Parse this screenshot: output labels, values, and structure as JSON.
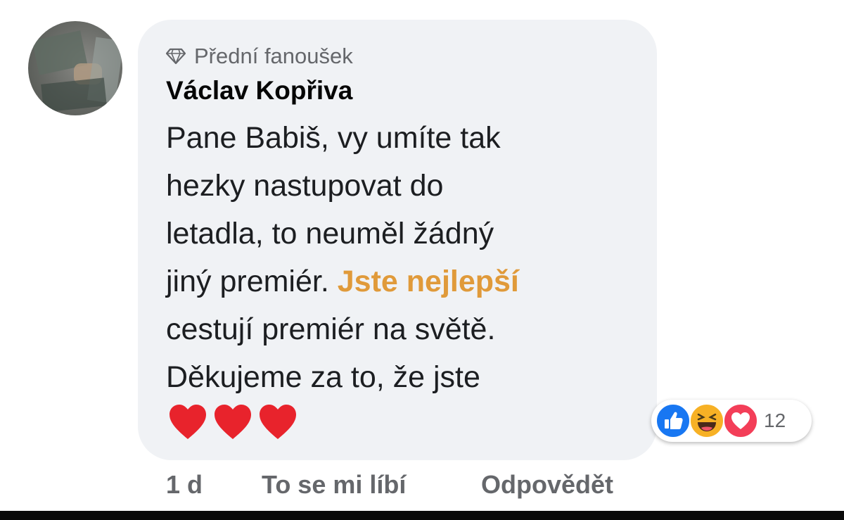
{
  "comment": {
    "badge_icon": "diamond-icon",
    "badge_label": "Přední fanoušek",
    "author": "Václav Kopřiva",
    "text_lines": [
      "Pane Babiš,  vy umíte tak",
      "hezky nastupovat do",
      "letadla,  to neuměl žádný"
    ],
    "line4_prefix": "jiný premiér. ",
    "line4_highlight": "Jste nejlepší",
    "line5": "cestují premiér na světě.",
    "line6": "Děkujeme za to,  že jste",
    "hearts": [
      "heart-icon",
      "heart-icon",
      "heart-icon"
    ],
    "highlight_color": "#e09a3a"
  },
  "reactions": {
    "icons": [
      "like-icon",
      "haha-icon",
      "love-icon"
    ],
    "count": "12"
  },
  "actions": {
    "time": "1 d",
    "like_label": "To se mi líbí",
    "reply_label": "Odpovědět"
  }
}
